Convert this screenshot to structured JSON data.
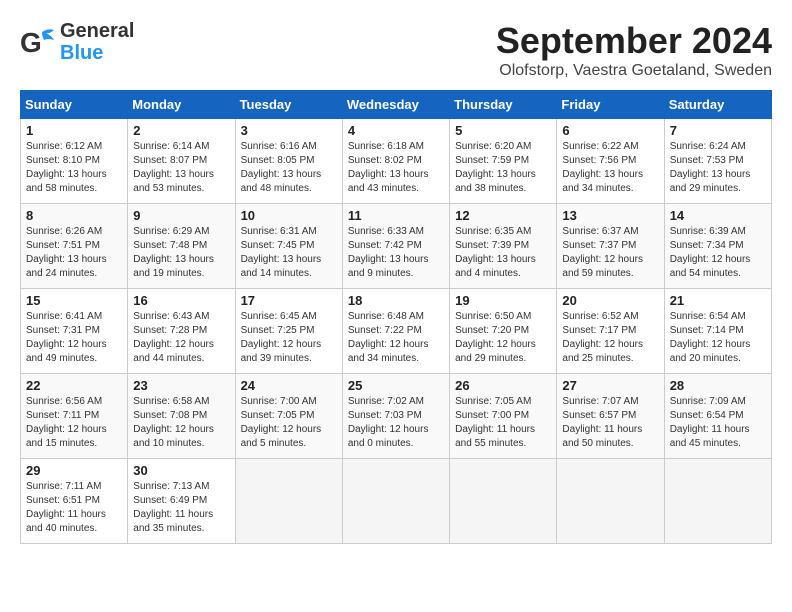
{
  "header": {
    "logo_general": "General",
    "logo_blue": "Blue",
    "month_title": "September 2024",
    "location": "Olofstorp, Vaestra Goetaland, Sweden"
  },
  "days_of_week": [
    "Sunday",
    "Monday",
    "Tuesday",
    "Wednesday",
    "Thursday",
    "Friday",
    "Saturday"
  ],
  "weeks": [
    [
      {
        "day": "1",
        "sunrise": "Sunrise: 6:12 AM",
        "sunset": "Sunset: 8:10 PM",
        "daylight": "Daylight: 13 hours and 58 minutes."
      },
      {
        "day": "2",
        "sunrise": "Sunrise: 6:14 AM",
        "sunset": "Sunset: 8:07 PM",
        "daylight": "Daylight: 13 hours and 53 minutes."
      },
      {
        "day": "3",
        "sunrise": "Sunrise: 6:16 AM",
        "sunset": "Sunset: 8:05 PM",
        "daylight": "Daylight: 13 hours and 48 minutes."
      },
      {
        "day": "4",
        "sunrise": "Sunrise: 6:18 AM",
        "sunset": "Sunset: 8:02 PM",
        "daylight": "Daylight: 13 hours and 43 minutes."
      },
      {
        "day": "5",
        "sunrise": "Sunrise: 6:20 AM",
        "sunset": "Sunset: 7:59 PM",
        "daylight": "Daylight: 13 hours and 38 minutes."
      },
      {
        "day": "6",
        "sunrise": "Sunrise: 6:22 AM",
        "sunset": "Sunset: 7:56 PM",
        "daylight": "Daylight: 13 hours and 34 minutes."
      },
      {
        "day": "7",
        "sunrise": "Sunrise: 6:24 AM",
        "sunset": "Sunset: 7:53 PM",
        "daylight": "Daylight: 13 hours and 29 minutes."
      }
    ],
    [
      {
        "day": "8",
        "sunrise": "Sunrise: 6:26 AM",
        "sunset": "Sunset: 7:51 PM",
        "daylight": "Daylight: 13 hours and 24 minutes."
      },
      {
        "day": "9",
        "sunrise": "Sunrise: 6:29 AM",
        "sunset": "Sunset: 7:48 PM",
        "daylight": "Daylight: 13 hours and 19 minutes."
      },
      {
        "day": "10",
        "sunrise": "Sunrise: 6:31 AM",
        "sunset": "Sunset: 7:45 PM",
        "daylight": "Daylight: 13 hours and 14 minutes."
      },
      {
        "day": "11",
        "sunrise": "Sunrise: 6:33 AM",
        "sunset": "Sunset: 7:42 PM",
        "daylight": "Daylight: 13 hours and 9 minutes."
      },
      {
        "day": "12",
        "sunrise": "Sunrise: 6:35 AM",
        "sunset": "Sunset: 7:39 PM",
        "daylight": "Daylight: 13 hours and 4 minutes."
      },
      {
        "day": "13",
        "sunrise": "Sunrise: 6:37 AM",
        "sunset": "Sunset: 7:37 PM",
        "daylight": "Daylight: 12 hours and 59 minutes."
      },
      {
        "day": "14",
        "sunrise": "Sunrise: 6:39 AM",
        "sunset": "Sunset: 7:34 PM",
        "daylight": "Daylight: 12 hours and 54 minutes."
      }
    ],
    [
      {
        "day": "15",
        "sunrise": "Sunrise: 6:41 AM",
        "sunset": "Sunset: 7:31 PM",
        "daylight": "Daylight: 12 hours and 49 minutes."
      },
      {
        "day": "16",
        "sunrise": "Sunrise: 6:43 AM",
        "sunset": "Sunset: 7:28 PM",
        "daylight": "Daylight: 12 hours and 44 minutes."
      },
      {
        "day": "17",
        "sunrise": "Sunrise: 6:45 AM",
        "sunset": "Sunset: 7:25 PM",
        "daylight": "Daylight: 12 hours and 39 minutes."
      },
      {
        "day": "18",
        "sunrise": "Sunrise: 6:48 AM",
        "sunset": "Sunset: 7:22 PM",
        "daylight": "Daylight: 12 hours and 34 minutes."
      },
      {
        "day": "19",
        "sunrise": "Sunrise: 6:50 AM",
        "sunset": "Sunset: 7:20 PM",
        "daylight": "Daylight: 12 hours and 29 minutes."
      },
      {
        "day": "20",
        "sunrise": "Sunrise: 6:52 AM",
        "sunset": "Sunset: 7:17 PM",
        "daylight": "Daylight: 12 hours and 25 minutes."
      },
      {
        "day": "21",
        "sunrise": "Sunrise: 6:54 AM",
        "sunset": "Sunset: 7:14 PM",
        "daylight": "Daylight: 12 hours and 20 minutes."
      }
    ],
    [
      {
        "day": "22",
        "sunrise": "Sunrise: 6:56 AM",
        "sunset": "Sunset: 7:11 PM",
        "daylight": "Daylight: 12 hours and 15 minutes."
      },
      {
        "day": "23",
        "sunrise": "Sunrise: 6:58 AM",
        "sunset": "Sunset: 7:08 PM",
        "daylight": "Daylight: 12 hours and 10 minutes."
      },
      {
        "day": "24",
        "sunrise": "Sunrise: 7:00 AM",
        "sunset": "Sunset: 7:05 PM",
        "daylight": "Daylight: 12 hours and 5 minutes."
      },
      {
        "day": "25",
        "sunrise": "Sunrise: 7:02 AM",
        "sunset": "Sunset: 7:03 PM",
        "daylight": "Daylight: 12 hours and 0 minutes."
      },
      {
        "day": "26",
        "sunrise": "Sunrise: 7:05 AM",
        "sunset": "Sunset: 7:00 PM",
        "daylight": "Daylight: 11 hours and 55 minutes."
      },
      {
        "day": "27",
        "sunrise": "Sunrise: 7:07 AM",
        "sunset": "Sunset: 6:57 PM",
        "daylight": "Daylight: 11 hours and 50 minutes."
      },
      {
        "day": "28",
        "sunrise": "Sunrise: 7:09 AM",
        "sunset": "Sunset: 6:54 PM",
        "daylight": "Daylight: 11 hours and 45 minutes."
      }
    ],
    [
      {
        "day": "29",
        "sunrise": "Sunrise: 7:11 AM",
        "sunset": "Sunset: 6:51 PM",
        "daylight": "Daylight: 11 hours and 40 minutes."
      },
      {
        "day": "30",
        "sunrise": "Sunrise: 7:13 AM",
        "sunset": "Sunset: 6:49 PM",
        "daylight": "Daylight: 11 hours and 35 minutes."
      },
      null,
      null,
      null,
      null,
      null
    ]
  ]
}
